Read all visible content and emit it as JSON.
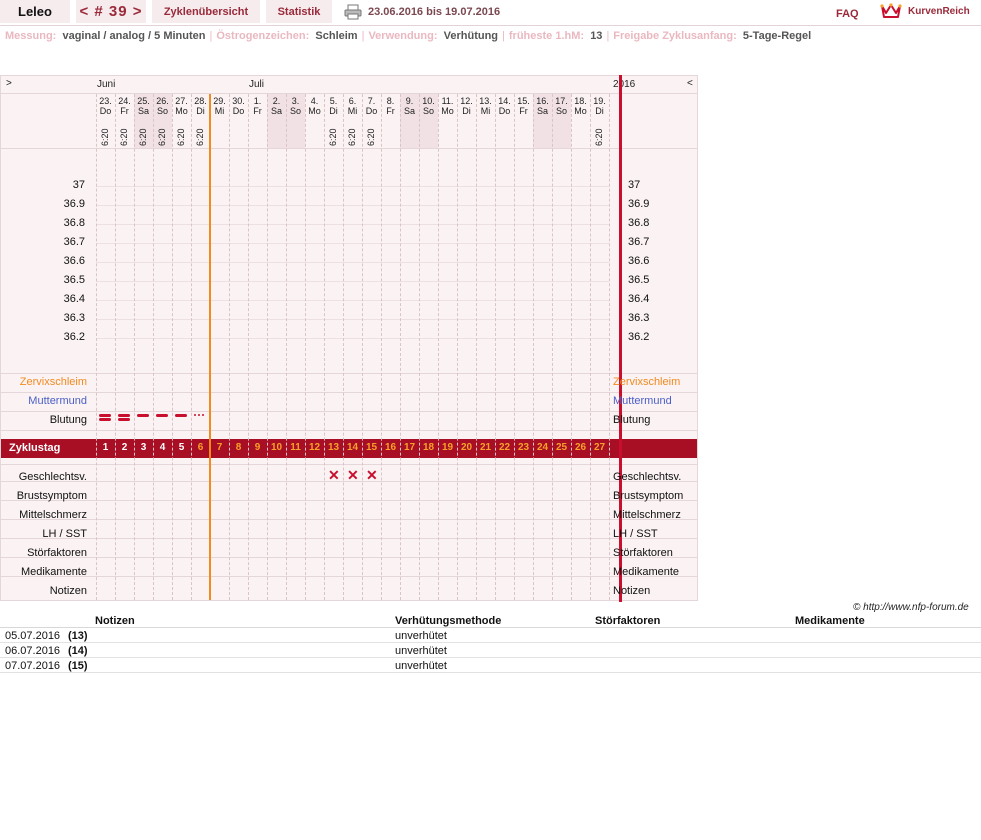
{
  "nav": {
    "user": "Leleo",
    "cycle": "< # 39 >",
    "overview": "Zyklenübersicht",
    "stats": "Statistik",
    "print_icon": "printer-icon",
    "date_range": "23.06.2016 bis 19.07.2016",
    "faq": "FAQ",
    "brand": "KurvenReich",
    "brand_icon": "crown-logo-icon"
  },
  "settings": [
    {
      "label": "Messung:",
      "value": "vaginal / analog / 5 Minuten"
    },
    {
      "label": "Östrogenzeichen:",
      "value": "Schleim"
    },
    {
      "label": "Verwendung:",
      "value": "Verhütung"
    },
    {
      "label": "früheste 1.hM:",
      "value": "13"
    },
    {
      "label": "Freigabe Zyklusanfang:",
      "value": "5-Tage-Regel"
    }
  ],
  "chart": {
    "nav_left": ">",
    "nav_right": "<",
    "year": "2016",
    "months": [
      {
        "label": "Juni",
        "day_index": 0
      },
      {
        "label": "Juli",
        "day_index": 8
      }
    ],
    "days": [
      {
        "num": "23.",
        "name": "Do",
        "time": "6:20",
        "weekend": false
      },
      {
        "num": "24.",
        "name": "Fr",
        "time": "6:20",
        "weekend": false
      },
      {
        "num": "25.",
        "name": "Sa",
        "time": "6:20",
        "weekend": true
      },
      {
        "num": "26.",
        "name": "So",
        "time": "6:20",
        "weekend": true
      },
      {
        "num": "27.",
        "name": "Mo",
        "time": "6:20",
        "weekend": false
      },
      {
        "num": "28.",
        "name": "Di",
        "time": "6:20",
        "weekend": false
      },
      {
        "num": "29.",
        "name": "Mi",
        "time": "",
        "weekend": false
      },
      {
        "num": "30.",
        "name": "Do",
        "time": "",
        "weekend": false
      },
      {
        "num": "1.",
        "name": "Fr",
        "time": "",
        "weekend": false
      },
      {
        "num": "2.",
        "name": "Sa",
        "time": "",
        "weekend": true
      },
      {
        "num": "3.",
        "name": "So",
        "time": "",
        "weekend": true
      },
      {
        "num": "4.",
        "name": "Mo",
        "time": "",
        "weekend": false
      },
      {
        "num": "5.",
        "name": "Di",
        "time": "6:20",
        "weekend": false
      },
      {
        "num": "6.",
        "name": "Mi",
        "time": "6:20",
        "weekend": false
      },
      {
        "num": "7.",
        "name": "Do",
        "time": "6:20",
        "weekend": false
      },
      {
        "num": "8.",
        "name": "Fr",
        "time": "",
        "weekend": false
      },
      {
        "num": "9.",
        "name": "Sa",
        "time": "",
        "weekend": true
      },
      {
        "num": "10.",
        "name": "So",
        "time": "",
        "weekend": true
      },
      {
        "num": "11.",
        "name": "Mo",
        "time": "",
        "weekend": false
      },
      {
        "num": "12.",
        "name": "Di",
        "time": "",
        "weekend": false
      },
      {
        "num": "13.",
        "name": "Mi",
        "time": "",
        "weekend": false
      },
      {
        "num": "14.",
        "name": "Do",
        "time": "",
        "weekend": false
      },
      {
        "num": "15.",
        "name": "Fr",
        "time": "",
        "weekend": false
      },
      {
        "num": "16.",
        "name": "Sa",
        "time": "",
        "weekend": true
      },
      {
        "num": "17.",
        "name": "So",
        "time": "",
        "weekend": true
      },
      {
        "num": "18.",
        "name": "Mo",
        "time": "",
        "weekend": false
      },
      {
        "num": "19.",
        "name": "Di",
        "time": "6:20",
        "weekend": false
      }
    ],
    "temperatures": [
      "37",
      "36.9",
      "36.8",
      "36.7",
      "36.6",
      "36.5",
      "36.4",
      "36.3",
      "36.2"
    ],
    "rows_top": [
      {
        "label": "Zervixschleim",
        "style": "orange"
      },
      {
        "label": "Muttermund",
        "style": "blue"
      },
      {
        "label": "Blutung",
        "style": "normal"
      }
    ],
    "bleeding": [
      {
        "day_index": 0,
        "intensity": "heavy"
      },
      {
        "day_index": 1,
        "intensity": "heavy"
      },
      {
        "day_index": 2,
        "intensity": "medium"
      },
      {
        "day_index": 3,
        "intensity": "medium"
      },
      {
        "day_index": 4,
        "intensity": "medium"
      },
      {
        "day_index": 5,
        "intensity": "spotting"
      }
    ],
    "current_day_index": 5,
    "cycle_label": "Zyklustag",
    "cycle_days": [
      "1",
      "2",
      "3",
      "4",
      "5",
      "6",
      "7",
      "8",
      "9",
      "10",
      "11",
      "12",
      "13",
      "14",
      "15",
      "16",
      "17",
      "18",
      "19",
      "20",
      "21",
      "22",
      "23",
      "24",
      "25",
      "26",
      "27"
    ],
    "infertile_through": 5,
    "rows_bottom": [
      {
        "label": "Geschlechtsv."
      },
      {
        "label": "Brustsymptom"
      },
      {
        "label": "Mittelschmerz"
      },
      {
        "label": "LH / SST"
      },
      {
        "label": "Störfaktoren"
      },
      {
        "label": "Medikamente"
      },
      {
        "label": "Notizen"
      }
    ],
    "intercourse_day_indices": [
      12,
      13,
      14
    ]
  },
  "copyright": "© http://www.nfp-forum.de",
  "notes": {
    "headers": [
      "Notizen",
      "Verhütungsmethode",
      "Störfaktoren",
      "Medikamente"
    ],
    "rows": [
      {
        "date": "05.07.2016",
        "cycle_day": "(13)",
        "note": "",
        "method": "unverhütet",
        "disturb": "",
        "meds": ""
      },
      {
        "date": "06.07.2016",
        "cycle_day": "(14)",
        "note": "",
        "method": "unverhütet",
        "disturb": "",
        "meds": ""
      },
      {
        "date": "07.07.2016",
        "cycle_day": "(15)",
        "note": "",
        "method": "unverhütet",
        "disturb": "",
        "meds": ""
      }
    ]
  }
}
